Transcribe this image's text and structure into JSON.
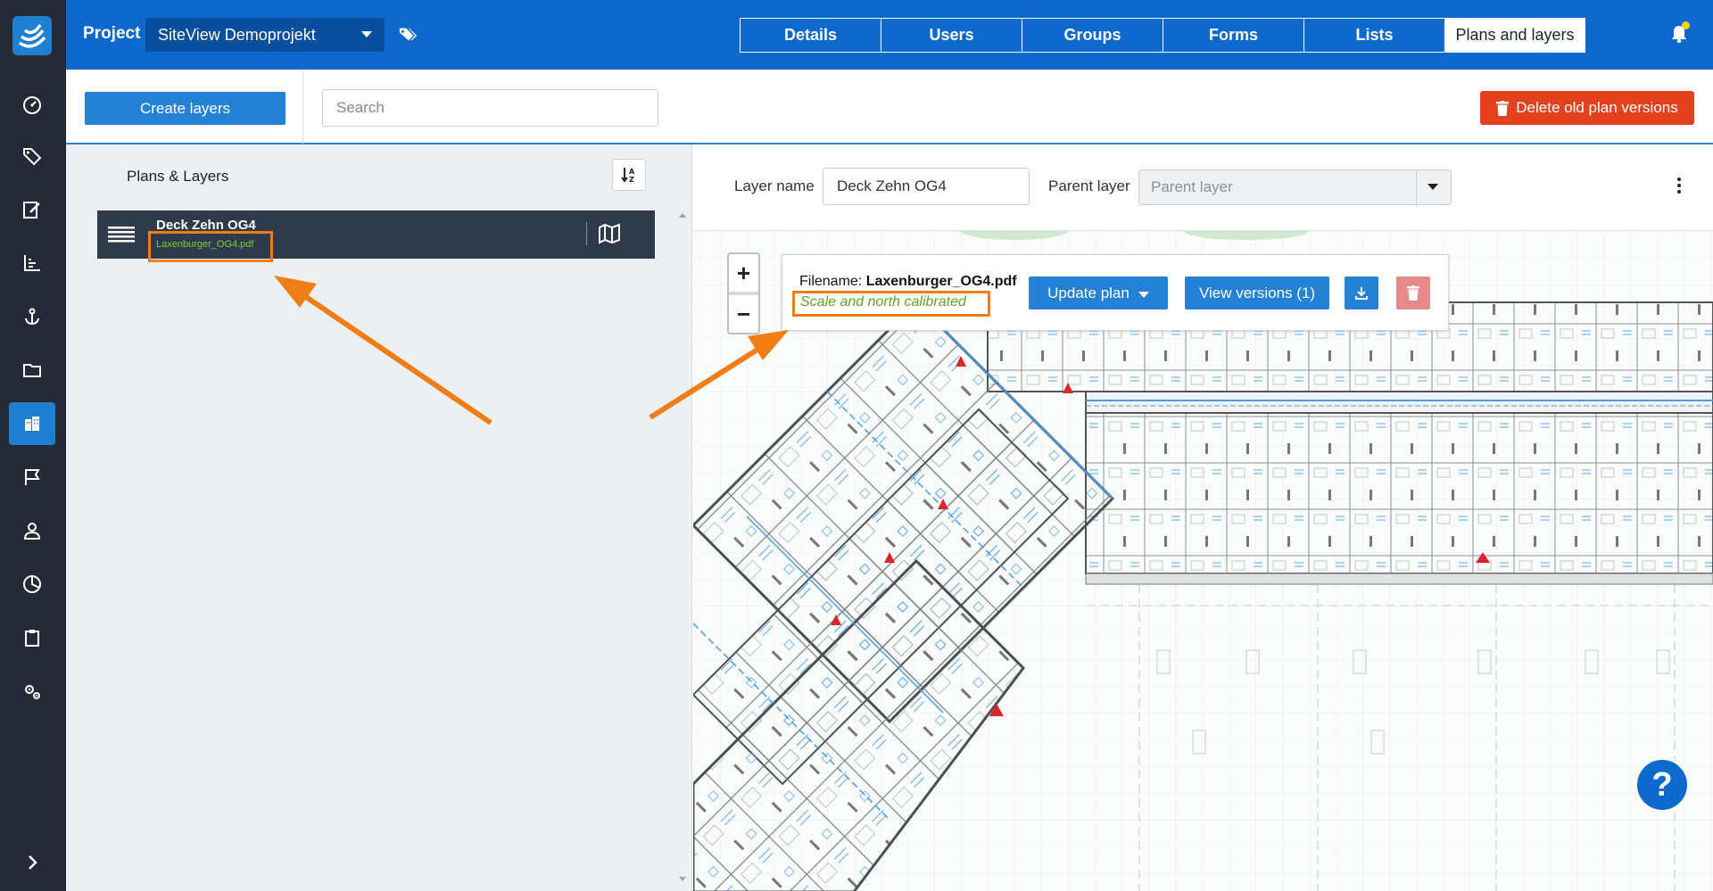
{
  "header": {
    "project_label": "Project",
    "project_name": "SiteView Demoprojekt",
    "tabs": [
      {
        "label": "Details",
        "active": false
      },
      {
        "label": "Users",
        "active": false
      },
      {
        "label": "Groups",
        "active": false
      },
      {
        "label": "Forms",
        "active": false
      },
      {
        "label": "Lists",
        "active": false
      },
      {
        "label": "Plans and layers",
        "active": true
      }
    ]
  },
  "sidebar": {
    "icons": [
      "dashboard-icon",
      "tags-icon",
      "edit-icon",
      "chart-icon",
      "anchor-icon",
      "folder-icon",
      "buildings-icon",
      "flag-icon",
      "user-icon",
      "pie-chart-icon",
      "clipboard-icon",
      "settings-icon"
    ],
    "active_icon": "buildings-icon",
    "expand_icon": "chevron-right-icon"
  },
  "toolbar": {
    "create_label": "Create layers",
    "search_placeholder": "Search",
    "delete_label": "Delete old plan versions"
  },
  "left_panel": {
    "title": "Plans & Layers",
    "layers": [
      {
        "name": "Deck Zehn OG4",
        "file": "Laxenburger_OG4.pdf"
      }
    ]
  },
  "editor": {
    "layer_name_label": "Layer name",
    "layer_name_value": "Deck Zehn OG4",
    "parent_layer_label": "Parent layer",
    "parent_layer_placeholder": "Parent layer"
  },
  "plan_popup": {
    "filename_label": "Filename:",
    "filename_value": "Laxenburger_OG4.pdf",
    "status": "Scale and north calibrated",
    "update_label": "Update plan",
    "versions_label": "View versions (1)"
  },
  "zoom": {
    "in": "+",
    "out": "−"
  },
  "help_label": "?",
  "colors": {
    "topbar": "#0d6acc",
    "rail": "#252b36",
    "primary_button": "#2581d6",
    "danger_button": "#e4411f",
    "highlight": "#f07d15",
    "calibrated_text": "#5aa624"
  }
}
